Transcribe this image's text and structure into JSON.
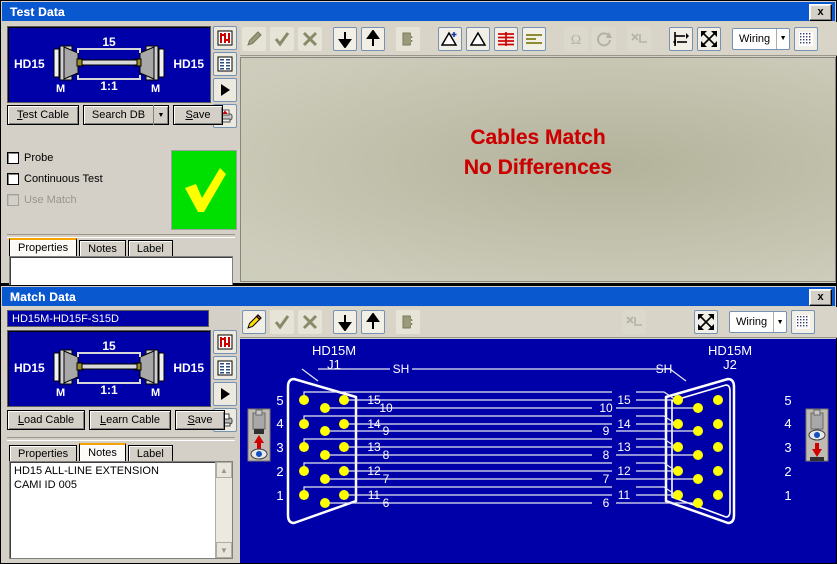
{
  "app": {
    "bg": "#000000",
    "face": "#d4d0c8"
  },
  "windows": {
    "test": {
      "title": "Test Data",
      "close_label": "x",
      "cable": {
        "left_connector": "HD15",
        "right_connector": "HD15",
        "left_gender": "M",
        "right_gender": "M",
        "pin_count": "15",
        "ratio": "1:1"
      },
      "side_buttons": [
        {
          "name": "netlist-icon",
          "title": "Netlist"
        },
        {
          "name": "list-view-icon",
          "title": "List View"
        },
        {
          "name": "run-icon",
          "title": "Run"
        },
        {
          "name": "print-icon",
          "title": "Print"
        }
      ],
      "buttons": {
        "test_cable": "Test Cable",
        "test_cable_accel": "T",
        "search_db": "Search DB",
        "save": "Save",
        "save_accel": "S"
      },
      "checkboxes": [
        {
          "label": "Probe",
          "checked": false,
          "enabled": true
        },
        {
          "label": "Continuous Test",
          "checked": false,
          "enabled": true
        },
        {
          "label": "Use Match",
          "checked": false,
          "enabled": false
        }
      ],
      "status": {
        "result": "pass",
        "glyph": "✓",
        "color": "#00e000"
      },
      "tabs": [
        {
          "label": "Properties",
          "active": true
        },
        {
          "label": "Notes",
          "active": false
        },
        {
          "label": "Label",
          "active": false
        }
      ],
      "tab_content": ""
    },
    "match": {
      "title": "Match Data",
      "close_label": "x",
      "match_name": "HD15M-HD15F-S15D",
      "cable": {
        "left_connector": "HD15",
        "right_connector": "HD15",
        "left_gender": "M",
        "right_gender": "M",
        "pin_count": "15",
        "ratio": "1:1"
      },
      "side_buttons": [
        {
          "name": "netlist-icon",
          "title": "Netlist"
        },
        {
          "name": "list-view-icon",
          "title": "List View"
        },
        {
          "name": "run-icon",
          "title": "Run"
        },
        {
          "name": "print-icon",
          "title": "Print"
        }
      ],
      "buttons": {
        "load_cable": "Load Cable",
        "load_cable_accel": "L",
        "learn_cable": "Learn Cable",
        "learn_cable_accel": "L",
        "save": "Save",
        "save_accel": "S"
      },
      "tabs": [
        {
          "label": "Properties",
          "active": false
        },
        {
          "label": "Notes",
          "active": true
        },
        {
          "label": "Label",
          "active": false
        }
      ],
      "notes_text": "HD15 ALL-LINE EXTENSION\nCAMI ID 005",
      "scroll": {
        "up": "▲",
        "down": "▼"
      }
    }
  },
  "toolbars": {
    "test": {
      "view_mode": "Wiring",
      "items": [
        {
          "name": "edit-pencil-icon",
          "style": "plain",
          "enabled": false
        },
        {
          "name": "accept-check-icon",
          "style": "plain",
          "enabled": false
        },
        {
          "name": "cancel-x-icon",
          "style": "plain",
          "enabled": false
        },
        {
          "name": "move-down-icon",
          "style": "raised",
          "enabled": true
        },
        {
          "name": "move-up-icon",
          "style": "raised",
          "enabled": true
        },
        {
          "name": "connector-icon",
          "style": "plain",
          "enabled": false
        },
        {
          "name": "add-measurement-icon",
          "style": "raised",
          "enabled": true
        },
        {
          "name": "measurement-icon",
          "style": "raised",
          "enabled": true
        },
        {
          "name": "red-lines-icon",
          "style": "raised",
          "enabled": true
        },
        {
          "name": "olive-lines-icon",
          "style": "raised",
          "enabled": true
        },
        {
          "name": "ohms-icon",
          "style": "dis",
          "enabled": false
        },
        {
          "name": "refresh-icon",
          "style": "dis",
          "enabled": false
        },
        {
          "name": "cut-net-icon",
          "style": "dis",
          "enabled": false
        },
        {
          "name": "swap-icon",
          "style": "raised",
          "enabled": true
        },
        {
          "name": "fit-to-window-icon",
          "style": "raised",
          "enabled": true
        },
        {
          "name": "grid-icon",
          "style": "raised",
          "enabled": true
        }
      ]
    },
    "match": {
      "view_mode": "Wiring",
      "items": [
        {
          "name": "edit-pencil-icon",
          "style": "raised",
          "enabled": true
        },
        {
          "name": "accept-check-icon",
          "style": "plain",
          "enabled": false
        },
        {
          "name": "cancel-x-icon",
          "style": "plain",
          "enabled": false
        },
        {
          "name": "move-down-icon",
          "style": "raised",
          "enabled": true
        },
        {
          "name": "move-up-icon",
          "style": "raised",
          "enabled": true
        },
        {
          "name": "connector-icon",
          "style": "plain",
          "enabled": false
        },
        {
          "name": "cut-net-icon",
          "style": "dis",
          "enabled": false
        },
        {
          "name": "fit-to-window-icon",
          "style": "raised",
          "enabled": true
        },
        {
          "name": "grid-icon",
          "style": "raised",
          "enabled": true
        }
      ]
    }
  },
  "diff_view": {
    "line1": "Cables Match",
    "line2": "No Differences",
    "text_color": "#cc0000"
  },
  "wiring_diagram": {
    "background": "#0000a8",
    "wire_color": "#e8e8f0",
    "pin_color": "#ffff00",
    "left_connector": {
      "type": "HD15M",
      "ref": "J1"
    },
    "right_connector": {
      "type": "HD15M",
      "ref": "J2"
    },
    "shield_label": "SH",
    "left_row_labels": [
      "5",
      "4",
      "3",
      "2",
      "1"
    ],
    "right_row_labels": [
      "5",
      "4",
      "3",
      "2",
      "1"
    ],
    "left_pin_labels": [
      "15",
      "10",
      "14",
      "9",
      "13",
      "8",
      "12",
      "7",
      "11",
      "6"
    ],
    "right_pin_labels": [
      "15",
      "10",
      "14",
      "9",
      "13",
      "8",
      "12",
      "7",
      "11",
      "6"
    ],
    "nets": [
      "SH",
      "1-1",
      "2-2",
      "3-3",
      "4-4",
      "5-5",
      "6-6",
      "7-7",
      "8-8",
      "9-9",
      "10-10",
      "11-11",
      "12-12",
      "13-13",
      "14-14",
      "15-15"
    ],
    "probe_left": {
      "name": "probe-source-icon",
      "direction": "up"
    },
    "probe_right": {
      "name": "probe-target-icon",
      "direction": "down"
    }
  }
}
